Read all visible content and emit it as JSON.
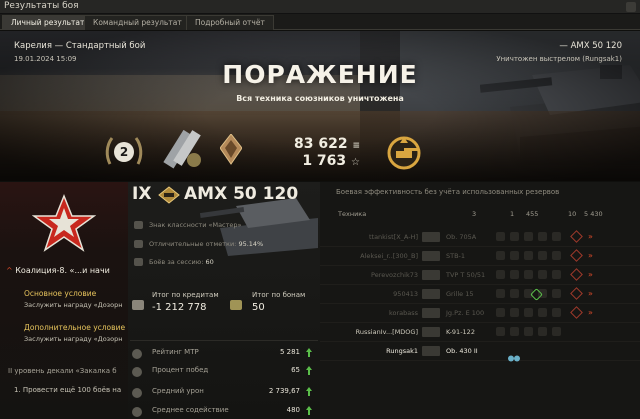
{
  "window": {
    "title": "Результаты боя"
  },
  "tabs": [
    {
      "label": "Личный результат",
      "active": true
    },
    {
      "label": "Командный результат",
      "active": false
    },
    {
      "label": "Подробный отчёт",
      "active": false
    }
  ],
  "battle": {
    "map": "Карелия — Стандартный бой",
    "date": "19.01.2024 15:09",
    "tank": "— AMX 50 120",
    "destroyed_by": "Уничтожен выстрелом (Rungsak1)",
    "result": "ПОРАЖЕНИЕ",
    "result_sub": "Вся техника союзников уничтожена"
  },
  "summary": {
    "rank": "2",
    "credits": "83 622",
    "xp": "1 763"
  },
  "mission": {
    "title": "Коалиция-8. «...и начи",
    "main_label": "Основное условие",
    "main_text": "Заслужить награду «Дозорн",
    "extra_label": "Дополнительное условие",
    "extra_text": "Заслужить награду «Дозорн",
    "level": "II уровень декали «Закалка б",
    "quest": "1. Провести ещё 100 боёв на"
  },
  "vehicle": {
    "tier": "IX",
    "name": "AMX 50 120",
    "achievements": [
      {
        "label": "Знак классности «Мастер»",
        "value": ""
      },
      {
        "label": "Отличительные отметки: ",
        "value": "95.14%"
      },
      {
        "label": "Боёв за сессию: ",
        "value": "60"
      }
    ],
    "credits_label": "Итог по кредитам",
    "credits_value": "-1 212 778",
    "bonds_label": "Итог по бонам",
    "bonds_value": "50"
  },
  "stats": [
    {
      "label": "Рейтинг МТР",
      "value": "5 281"
    },
    {
      "label": "Процент побед",
      "value": "65"
    },
    {
      "label": "Средний урон",
      "value": "2 739,67"
    },
    {
      "label": "Среднее содействие",
      "value": "480"
    }
  ],
  "efficiency": {
    "header": "Боевая эффективность без учёта использованных резервов",
    "col_vehicle": "Техника",
    "cols": [
      "3",
      "1",
      "455",
      "10",
      "5 430"
    ],
    "rows": [
      {
        "player": "ttankist[X_A-H]",
        "vehicle": "Ob. 705A",
        "state": "dead"
      },
      {
        "player": "Aleksei_r..[300_B]",
        "vehicle": "STB-1",
        "state": "dead"
      },
      {
        "player": "Perevozchik73",
        "vehicle": "TVP T 50/51",
        "state": "dead"
      },
      {
        "player": "950413",
        "vehicle": "Grille 15",
        "state": "dead"
      },
      {
        "player": "korabass",
        "vehicle": "Jg.Pz. E 100",
        "state": "dead"
      },
      {
        "player": "RussianIv...[MDOG]",
        "vehicle": "K-91-122",
        "state": "alive"
      },
      {
        "player": "Rungsak1",
        "vehicle": "Ob. 430 II",
        "state": "me"
      }
    ]
  },
  "colors": {
    "accent": "#e6c35c",
    "defeat": "#f6f2e8",
    "up": "#5bbf4a",
    "damage": "#d84a2a"
  }
}
